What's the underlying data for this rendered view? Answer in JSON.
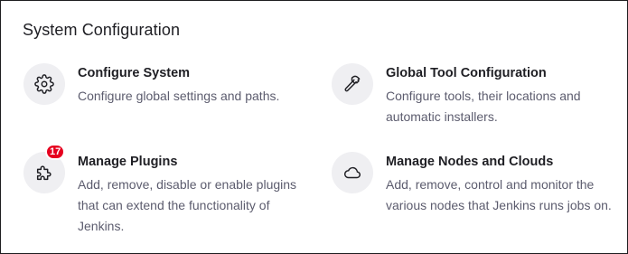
{
  "section": {
    "title": "System Configuration"
  },
  "items": [
    {
      "icon": "gear-icon",
      "title": "Configure System",
      "description": "Configure global settings and paths."
    },
    {
      "icon": "hammer-icon",
      "title": "Global Tool Configuration",
      "description": "Configure tools, their locations and automatic installers."
    },
    {
      "icon": "puzzle-icon",
      "title": "Manage Plugins",
      "description": "Add, remove, disable or enable plugins that can extend the functionality of Jenkins.",
      "badge": "17"
    },
    {
      "icon": "cloud-icon",
      "title": "Manage Nodes and Clouds",
      "description": "Add, remove, control and monitor the various nodes that Jenkins runs jobs on."
    }
  ],
  "colors": {
    "badge": "#e6001f",
    "icon_bg": "#efeff2",
    "title": "#1f1f24",
    "description": "#5c5c6e"
  }
}
